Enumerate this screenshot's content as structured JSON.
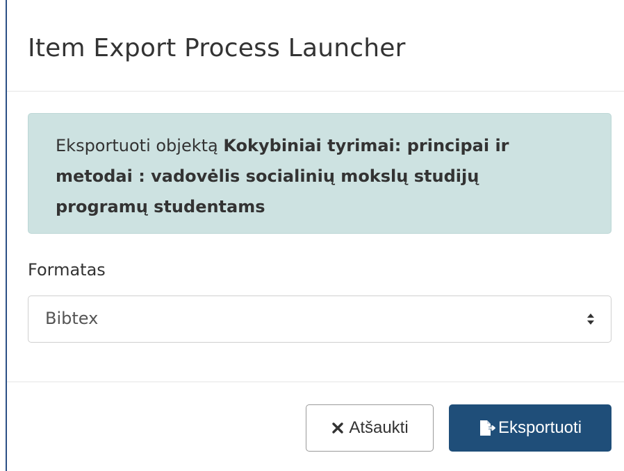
{
  "modal": {
    "title": "Item Export Process Launcher"
  },
  "alert": {
    "prefix": "Eksportuoti objektą",
    "object_title": "Kokybiniai tyrimai: principai ir metodai : vadovėlis socialinių mokslų studijų programų studentams"
  },
  "form": {
    "format_label": "Formatas",
    "format_selected": "Bibtex"
  },
  "footer": {
    "cancel_label": "Atšaukti",
    "export_label": "Eksportuoti"
  },
  "icons": {
    "cancel": "close-icon",
    "export": "file-export-icon",
    "select": "sort-arrows-icon"
  },
  "colors": {
    "alert_bg": "#cde2e1",
    "primary": "#1f4e79"
  }
}
